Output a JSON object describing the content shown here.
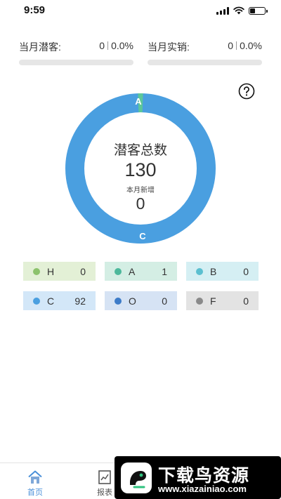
{
  "status_bar": {
    "time": "9:59",
    "battery_level": 0.35
  },
  "monthly": {
    "left": {
      "label": "当月潜客:",
      "count": "0",
      "percent": "0.0%",
      "progress": 0
    },
    "right": {
      "label": "当月实销:",
      "count": "0",
      "percent": "0.0%",
      "progress": 0
    }
  },
  "help": {
    "icon": "question-circle-icon"
  },
  "donut": {
    "title": "潜客总数",
    "total": "130",
    "new_label": "本月新增",
    "new_value": "0",
    "marker_top": "A",
    "marker_bottom": "C",
    "colors": {
      "main": "#4a9fe0",
      "accent": "#5cc79a"
    }
  },
  "chart_data": {
    "type": "pie",
    "categories": [
      "H",
      "A",
      "B",
      "C",
      "O",
      "F"
    ],
    "values": [
      0,
      1,
      0,
      92,
      0,
      0
    ],
    "colors": [
      "#8cc26c",
      "#4cb89b",
      "#5bbfd0",
      "#4a9fe0",
      "#3d7bc8",
      "#8a8a8a"
    ]
  },
  "levels": [
    {
      "name": "H",
      "count": "0",
      "dot_color": "#8cc26c",
      "bg": "#e3f0d6"
    },
    {
      "name": "A",
      "count": "1",
      "dot_color": "#4cb89b",
      "bg": "#d4eee4"
    },
    {
      "name": "B",
      "count": "0",
      "dot_color": "#5bbfd0",
      "bg": "#d5eff3"
    },
    {
      "name": "C",
      "count": "92",
      "dot_color": "#4a9fe0",
      "bg": "#d3e7f8"
    },
    {
      "name": "O",
      "count": "0",
      "dot_color": "#3d7bc8",
      "bg": "#d6e3f4"
    },
    {
      "name": "F",
      "count": "0",
      "dot_color": "#8a8a8a",
      "bg": "#e3e3e3"
    }
  ],
  "tabbar": {
    "home": {
      "label": "首页",
      "icon": "home-icon"
    },
    "report": {
      "label": "报表",
      "icon": "report-icon"
    }
  },
  "watermark": {
    "title": "下载鸟资源",
    "url": "www.xiazainiao.com"
  }
}
